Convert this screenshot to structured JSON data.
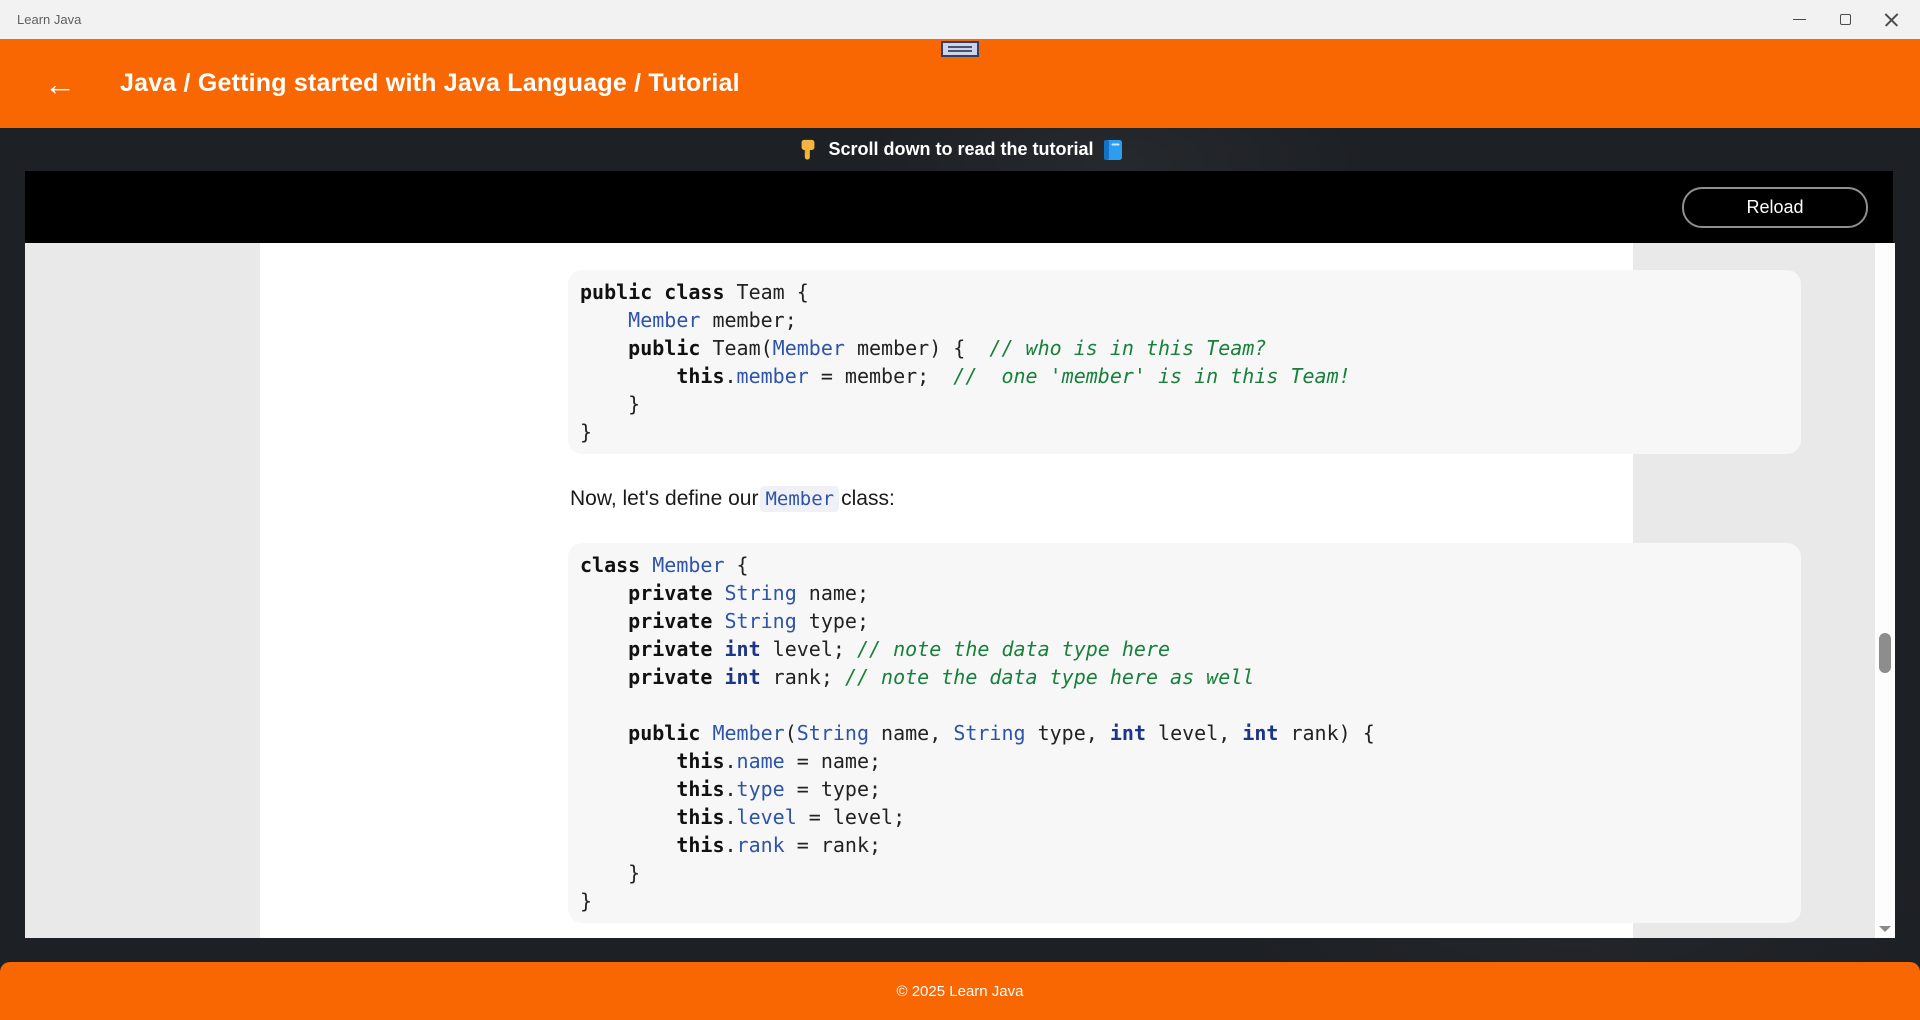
{
  "window": {
    "title": "Learn Java",
    "controls": {
      "minimize_icon": "minimize-icon",
      "restore_icon": "restore-icon",
      "close_icon": "close-icon"
    }
  },
  "header": {
    "back_icon": "back-arrow-icon",
    "back_glyph": "←",
    "breadcrumb": "Java / Getting started with Java Language / Tutorial",
    "tab_widget_icon": "drag-handle-icon"
  },
  "notice": {
    "icon_left": "point-down-hand-icon",
    "text": "Scroll down to read the tutorial",
    "icon_right": "blue-book-icon"
  },
  "toolbar": {
    "reload_label": "Reload"
  },
  "tutorial": {
    "paragraph": {
      "before": "Now, let's define our",
      "code_text": "Member",
      "after": "class:"
    }
  },
  "code_blocks": [
    {
      "name": "team-class-snippet",
      "lines": [
        [
          [
            "k",
            "public"
          ],
          [
            "p",
            " "
          ],
          [
            "k",
            "class"
          ],
          [
            "p",
            " Team {"
          ]
        ],
        [
          [
            "p",
            "    "
          ],
          [
            "t",
            "Member"
          ],
          [
            "p",
            " member;"
          ]
        ],
        [
          [
            "p",
            "    "
          ],
          [
            "k",
            "public"
          ],
          [
            "p",
            " Team("
          ],
          [
            "t",
            "Member"
          ],
          [
            "p",
            " member) {  "
          ],
          [
            "c",
            "// who is in this Team?"
          ]
        ],
        [
          [
            "p",
            "        "
          ],
          [
            "k",
            "this"
          ],
          [
            "p",
            "."
          ],
          [
            "f",
            "member"
          ],
          [
            "p",
            " = member;  "
          ],
          [
            "c",
            "//  one 'member' is in this Team!"
          ]
        ],
        [
          [
            "p",
            "    }"
          ]
        ],
        [
          [
            "p",
            "}"
          ]
        ]
      ]
    },
    {
      "name": "member-class-snippet",
      "lines": [
        [
          [
            "k",
            "class"
          ],
          [
            "p",
            " "
          ],
          [
            "t",
            "Member"
          ],
          [
            "p",
            " {"
          ]
        ],
        [
          [
            "p",
            "    "
          ],
          [
            "k",
            "private"
          ],
          [
            "p",
            " "
          ],
          [
            "t",
            "String"
          ],
          [
            "p",
            " name;"
          ]
        ],
        [
          [
            "p",
            "    "
          ],
          [
            "k",
            "private"
          ],
          [
            "p",
            " "
          ],
          [
            "t",
            "String"
          ],
          [
            "p",
            " type;"
          ]
        ],
        [
          [
            "p",
            "    "
          ],
          [
            "k",
            "private"
          ],
          [
            "p",
            " "
          ],
          [
            "i",
            "int"
          ],
          [
            "p",
            " level; "
          ],
          [
            "c",
            "// note the data type here"
          ]
        ],
        [
          [
            "p",
            "    "
          ],
          [
            "k",
            "private"
          ],
          [
            "p",
            " "
          ],
          [
            "i",
            "int"
          ],
          [
            "p",
            " rank; "
          ],
          [
            "c",
            "// note the data type here as well"
          ]
        ],
        [],
        [
          [
            "p",
            "    "
          ],
          [
            "k",
            "public"
          ],
          [
            "p",
            " "
          ],
          [
            "t",
            "Member"
          ],
          [
            "p",
            "("
          ],
          [
            "t",
            "String"
          ],
          [
            "p",
            " name, "
          ],
          [
            "t",
            "String"
          ],
          [
            "p",
            " type, "
          ],
          [
            "i",
            "int"
          ],
          [
            "p",
            " level, "
          ],
          [
            "i",
            "int"
          ],
          [
            "p",
            " rank) {"
          ]
        ],
        [
          [
            "p",
            "        "
          ],
          [
            "k",
            "this"
          ],
          [
            "p",
            "."
          ],
          [
            "f",
            "name"
          ],
          [
            "p",
            " = name;"
          ]
        ],
        [
          [
            "p",
            "        "
          ],
          [
            "k",
            "this"
          ],
          [
            "p",
            "."
          ],
          [
            "f",
            "type"
          ],
          [
            "p",
            " = type;"
          ]
        ],
        [
          [
            "p",
            "        "
          ],
          [
            "k",
            "this"
          ],
          [
            "p",
            "."
          ],
          [
            "f",
            "level"
          ],
          [
            "p",
            " = level;"
          ]
        ],
        [
          [
            "p",
            "        "
          ],
          [
            "k",
            "this"
          ],
          [
            "p",
            "."
          ],
          [
            "f",
            "rank"
          ],
          [
            "p",
            " = rank;"
          ]
        ],
        [
          [
            "p",
            "    }"
          ]
        ],
        [
          [
            "p",
            "}"
          ]
        ]
      ]
    }
  ],
  "footer": {
    "copyright": "© 2025 Learn Java"
  },
  "colors": {
    "accent_orange": "#f96702",
    "toolbar_black": "#000000",
    "frame_dark": "#1d2024",
    "page_gray": "#e9e9e9",
    "code_bg": "#f7f7f8",
    "code_keyword": "#111111",
    "code_type_blue": "#2d54a9",
    "code_int_navy": "#1c3687",
    "code_comment_green": "#18803a"
  }
}
